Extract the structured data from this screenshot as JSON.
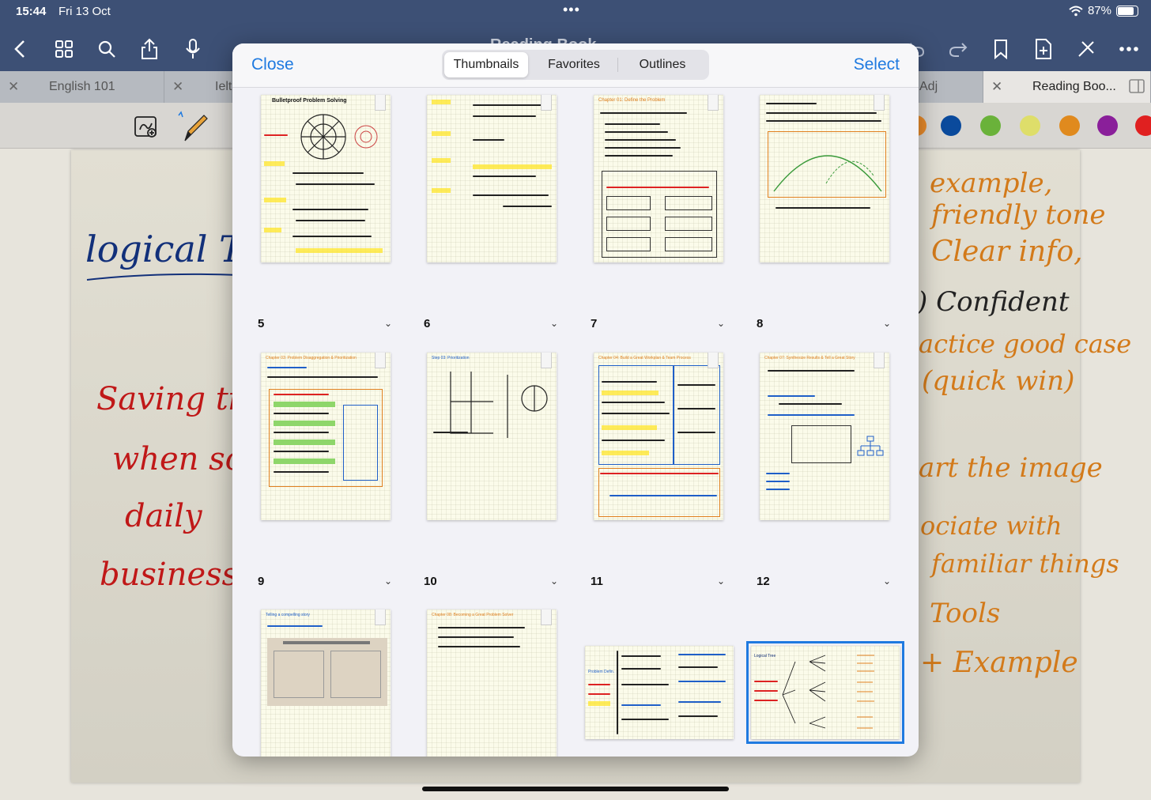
{
  "status": {
    "time": "15:44",
    "date": "Fri 13 Oct",
    "battery": "87%",
    "dots": "•••"
  },
  "toolbar": {
    "title": "Reading Book"
  },
  "tabs": [
    {
      "label": "English 101"
    },
    {
      "label": "Ielt"
    },
    {
      "label": "Adj"
    },
    {
      "label": "Reading Boo..."
    }
  ],
  "colors": {
    "accent": "#1f7ae0",
    "toolbar": "#3d5075",
    "swatches": [
      "#e98b2b",
      "#0a4a9c",
      "#6ab23a",
      "#dede6a",
      "#e08a1e",
      "#8a1f9a",
      "#e02020"
    ]
  },
  "page": {
    "left_notes": [
      "logical Tree",
      "Saving time",
      "when solving",
      "daily",
      "business prob"
    ],
    "right_notes": [
      "example,",
      "friendly tone",
      "Clear info,",
      ") Confident",
      "actice good case",
      "(quick win)",
      "art the image",
      "ociate with",
      "familiar things",
      "Tools",
      "+ Example"
    ]
  },
  "modal": {
    "close": "Close",
    "select": "Select",
    "tabs": [
      "Thumbnails",
      "Favorites",
      "Outlines"
    ],
    "active_tab": "Thumbnails",
    "pages": [
      {
        "number": "5",
        "title": "Bulletproof Problem Solving"
      },
      {
        "number": "6",
        "title": ""
      },
      {
        "number": "7",
        "title": "Chapter 01: Define the Problem"
      },
      {
        "number": "8",
        "title": ""
      },
      {
        "number": "9",
        "title": "Chapter 03: Problem Disaggregation & Prioritization"
      },
      {
        "number": "10",
        "title": "Step 03: Prioritization"
      },
      {
        "number": "11",
        "title": "Chapter 04: Build a Great Workplan & Team Process"
      },
      {
        "number": "12",
        "title": "Chapter 07: Synthesize Results & Tell a Great Story"
      },
      {
        "number": "",
        "title": "Telling a compelling story"
      },
      {
        "number": "",
        "title": "Chapter 08: Becoming a Great Problem Solver"
      },
      {
        "number": "",
        "title": "Problem Defin."
      },
      {
        "number": "",
        "title": "Logical Tree"
      }
    ]
  }
}
